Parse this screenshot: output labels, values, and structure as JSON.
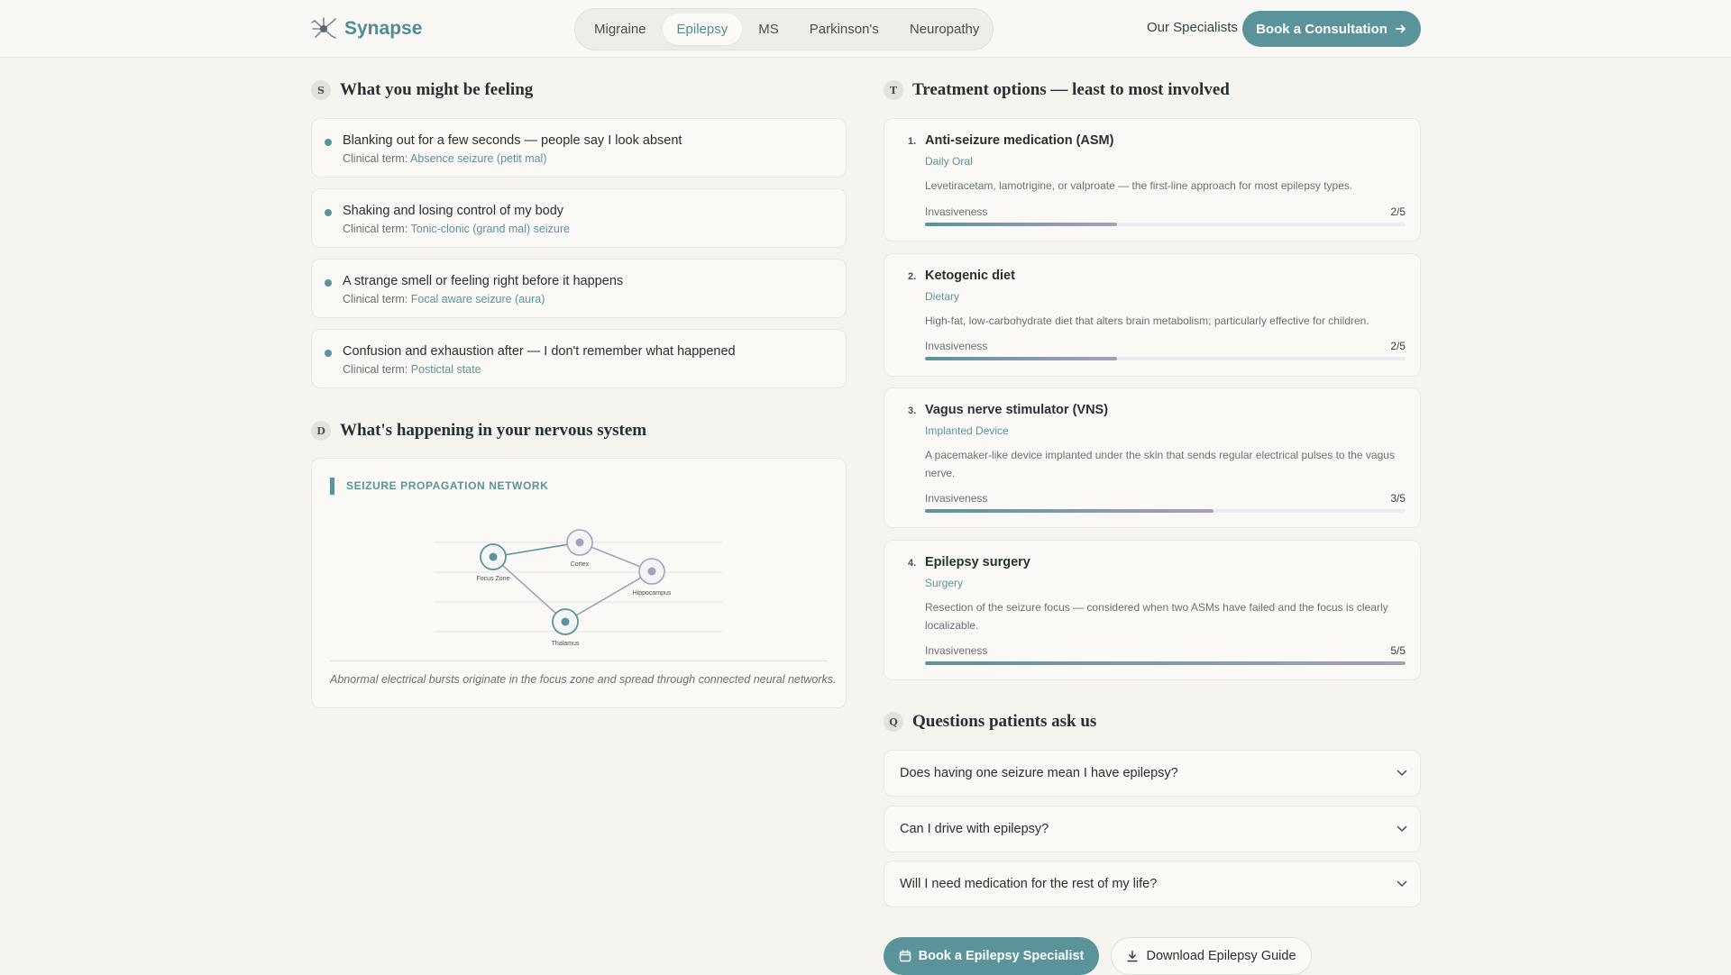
{
  "brand": {
    "name": "Synapse",
    "logo_icon": "neuron-logo-icon"
  },
  "nav": {
    "items": [
      "Migraine",
      "Epilepsy",
      "MS",
      "Parkinson's",
      "Neuropathy"
    ],
    "active": "Epilepsy"
  },
  "header": {
    "specialists_link": "Our Specialists",
    "consult_button": "Book a Consultation"
  },
  "colors": {
    "accent": "#5a949a",
    "accent_secondary": "#a99fbd",
    "background": "#f6f4ef"
  },
  "symptoms": {
    "badge": "S",
    "title": "What you might be feeling",
    "clinical_prefix": "Clinical term:",
    "items": [
      {
        "text": "Blanking out for a few seconds — people say I look absent",
        "clinical": "Absence seizure (petit mal)"
      },
      {
        "text": "Shaking and losing control of my body",
        "clinical": "Tonic-clonic (grand mal) seizure"
      },
      {
        "text": "A strange smell or feeling right before it happens",
        "clinical": "Focal aware seizure (aura)"
      },
      {
        "text": "Confusion and exhaustion after — I don't remember what happened",
        "clinical": "Postictal state"
      }
    ]
  },
  "nervous": {
    "badge": "D",
    "title": "What's happening in your nervous system",
    "diagram_label": "SEIZURE PROPAGATION NETWORK",
    "nodes": [
      "Focus Zone",
      "Cortex",
      "Hippocampus",
      "Thalamus"
    ],
    "caption": "Abnormal electrical bursts originate in the focus zone and spread through connected neural networks."
  },
  "treatments": {
    "badge": "T",
    "title": "Treatment options — least to most involved",
    "invasiveness_label": "Invasiveness",
    "items": [
      {
        "num": "1.",
        "name": "Anti-seizure medication (ASM)",
        "kind": "Daily Oral",
        "desc": "Levetiracetam, lamotrigine, or valproate — the first-line approach for most epilepsy types.",
        "score": "2/5",
        "level": 0.4
      },
      {
        "num": "2.",
        "name": "Ketogenic diet",
        "kind": "Dietary",
        "desc": "High-fat, low-carbohydrate diet that alters brain metabolism; particularly effective for children.",
        "score": "2/5",
        "level": 0.4
      },
      {
        "num": "3.",
        "name": "Vagus nerve stimulator (VNS)",
        "kind": "Implanted Device",
        "desc": "A pacemaker-like device implanted under the skin that sends regular electrical pulses to the vagus nerve.",
        "score": "3/5",
        "level": 0.6
      },
      {
        "num": "4.",
        "name": "Epilepsy surgery",
        "kind": "Surgery",
        "desc": "Resection of the seizure focus — considered when two ASMs have failed and the focus is clearly localizable.",
        "score": "5/5",
        "level": 1.0
      }
    ]
  },
  "faq": {
    "badge": "Q",
    "title": "Questions patients ask us",
    "items": [
      "Does having one seizure mean I have epilepsy?",
      "Can I drive with epilepsy?",
      "Will I need medication for the rest of my life?"
    ]
  },
  "actions": {
    "book": "Book a Epilepsy Specialist",
    "download": "Download Epilepsy Guide"
  }
}
